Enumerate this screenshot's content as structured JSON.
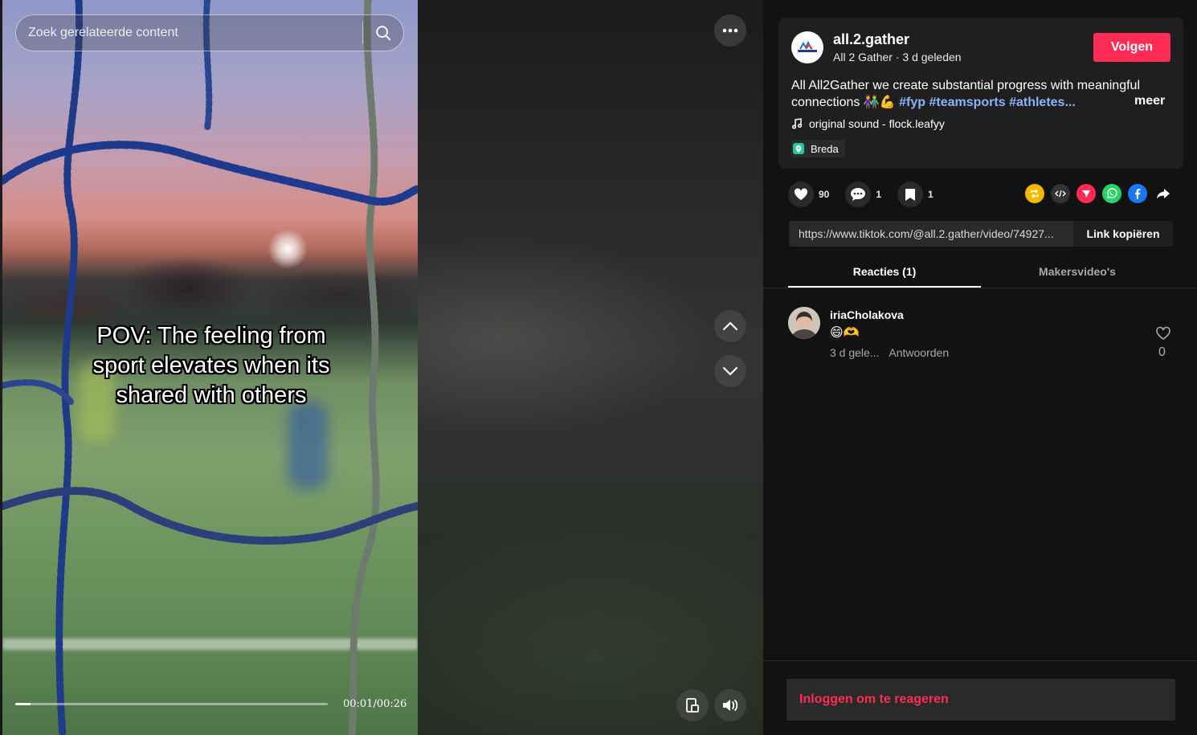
{
  "search": {
    "placeholder": "Zoek gerelateerde content"
  },
  "video": {
    "caption_lines": [
      "POV: The feeling from",
      "sport elevates when its",
      "shared with others"
    ],
    "time": "00:01/00:26",
    "progress": 0.05
  },
  "author": {
    "username": "all.2.gather",
    "display_name": "All 2 Gather",
    "posted": "3 d geleden",
    "follow_label": "Volgen"
  },
  "description": {
    "text": "All All2Gather we create substantial progress with meaningful connections 👫💪",
    "hashtags": "#fyp #teamsports #athletes...",
    "more_label": "meer"
  },
  "music": "original sound - flock.leafyy",
  "location": "Breda",
  "stats": {
    "likes": "90",
    "comments": "1",
    "saves": "1"
  },
  "share_icons": [
    "repost-icon",
    "embed-icon",
    "send-icon",
    "whatsapp-icon",
    "facebook-icon",
    "share-icon"
  ],
  "link": {
    "url": "https://www.tiktok.com/@all.2.gather/video/74927...",
    "copy_label": "Link kopiëren"
  },
  "tabs": [
    {
      "label": "Reacties (1)",
      "active": true
    },
    {
      "label": "Makersvideo's",
      "active": false
    }
  ],
  "comments": [
    {
      "user": "iriaCholakova",
      "text": "😄🫶",
      "time": "3 d gele...",
      "reply_label": "Antwoorden",
      "likes": "0"
    }
  ],
  "login_prompt": "Inloggen om te reageren",
  "colors": {
    "accent": "#fe2c55",
    "hashtag": "#8bb3ff",
    "panel": "#121212",
    "card": "#1f1f1f"
  }
}
